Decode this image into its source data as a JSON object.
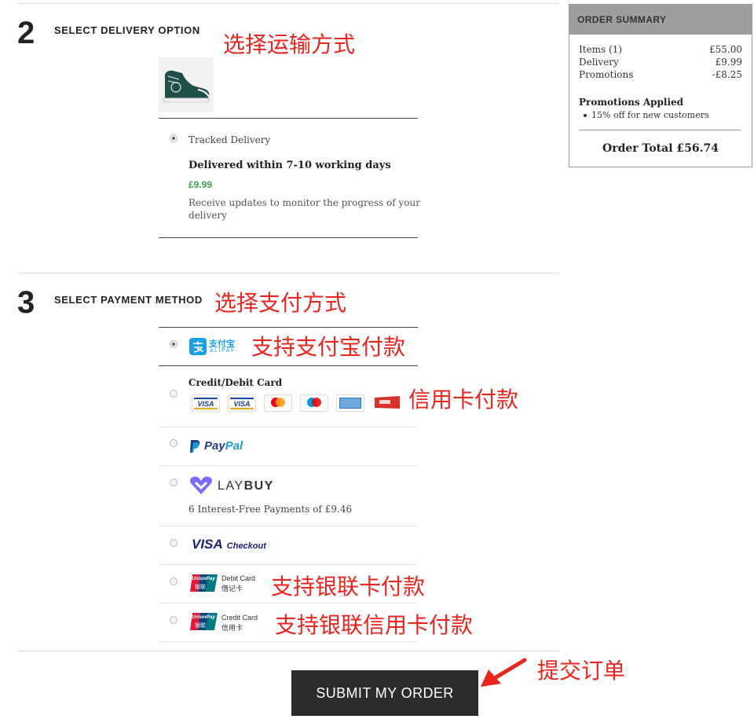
{
  "delivery": {
    "step_number": "2",
    "title": "SELECT DELIVERY OPTION",
    "annotation": "选择运输方式",
    "option": {
      "label": "Tracked Delivery",
      "heading": "Delivered within 7-10 working days",
      "price": "£9.99",
      "description_line1": "Receive updates to monitor the progress of your",
      "description_line2": "delivery"
    }
  },
  "payment": {
    "step_number": "3",
    "title": "SELECT PAYMENT METHOD",
    "annotation": "选择支付方式",
    "alipay": {
      "logo_cn": "支付宝",
      "logo_en": "ALIPAY",
      "annotation": "支持支付宝付款"
    },
    "card": {
      "label": "Credit/Debit Card",
      "annotation": "信用卡付款",
      "logos": [
        "VISA",
        "VISA",
        "mastercard",
        "maestro",
        "amex",
        "diners"
      ]
    },
    "paypal": {
      "logo_p": "Pay",
      "logo_pal": "Pal"
    },
    "laybuy": {
      "logo_lay": "LAY",
      "logo_buy": "BUY",
      "note": "6 Interest-Free Payments of £9.46"
    },
    "visa_checkout": {
      "logo_visa": "VISA",
      "logo_checkout": "Checkout"
    },
    "unionpay_debit": {
      "line1": "Debit Card",
      "line2": "借记卡",
      "annotation": "支持银联卡付款",
      "logo_text": "UnionPay",
      "logo_cn": "银联"
    },
    "unionpay_credit": {
      "line1": "Credit Card",
      "line2": "信用卡",
      "annotation": "支持银联信用卡付款",
      "logo_text": "UnionPay",
      "logo_cn": "银联"
    }
  },
  "summary": {
    "title": "ORDER SUMMARY",
    "rows": [
      {
        "label": "Items (1)",
        "value": "£55.00"
      },
      {
        "label": "Delivery",
        "value": "£9.99"
      },
      {
        "label": "Promotions",
        "value": "-£8.25"
      }
    ],
    "promotions_heading": "Promotions Applied",
    "promotion_item": "15% off for new customers",
    "total": "Order Total £56.74"
  },
  "submit": {
    "label": "SUBMIT MY ORDER",
    "annotation": "提交订单"
  },
  "colors": {
    "annotation_red": "#e8251f",
    "price_green": "#3fa34d",
    "button_dark": "#2c2c2c"
  }
}
